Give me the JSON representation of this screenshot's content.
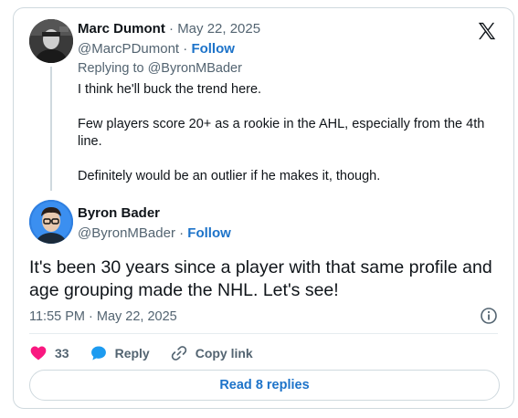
{
  "quoted_tweet": {
    "author_name": "Marc Dumont",
    "date": "May 22, 2025",
    "handle": "@MarcPDumont",
    "follow_label": "Follow",
    "replying_to": "Replying to @ByronMBader",
    "paragraphs": [
      "I think he'll buck the trend here.",
      "Few players score 20+ as a rookie in the AHL, especially from the 4th line.",
      "Definitely would be an outlier if he makes it, though."
    ]
  },
  "main_tweet": {
    "author_name": "Byron Bader",
    "handle": "@ByronMBader",
    "follow_label": "Follow",
    "text": "It's been 30 years since a player with that same profile and age grouping made the NHL. Let's see!",
    "timestamp": "11:55 PM · May 22, 2025"
  },
  "actions": {
    "like_count": "33",
    "reply_label": "Reply",
    "copy_link_label": "Copy link"
  },
  "read_replies_label": "Read 8 replies",
  "icons": {
    "brand": "x-logo-icon",
    "info": "info-icon",
    "like": "heart-icon",
    "reply": "speech-bubble-icon",
    "copy": "link-icon"
  },
  "colors": {
    "like": "#f91880",
    "link": "#1d73c9",
    "reply_icon": "#1d9bf0",
    "muted": "#536471",
    "border": "#cfd9de"
  }
}
